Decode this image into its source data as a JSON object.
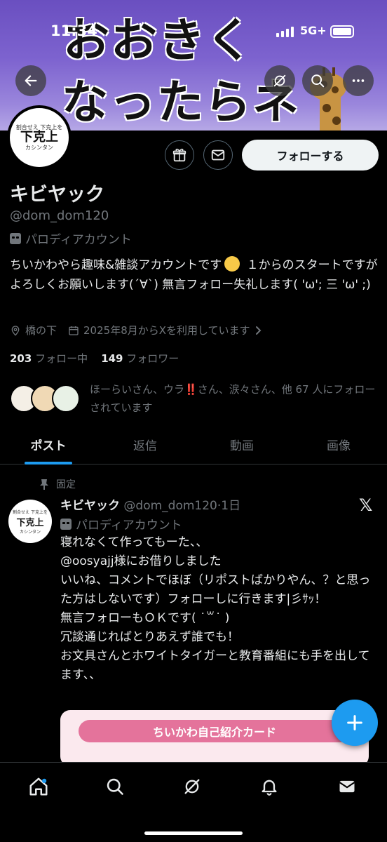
{
  "status_bar": {
    "time": "11:34",
    "network": "5G+"
  },
  "banner": {
    "line1": "おおきく",
    "line2": "なったらネ"
  },
  "avatar": {
    "small_top": "割合せえ 下克上を",
    "big": "下克上",
    "small_bottom": "カシンタン"
  },
  "profile": {
    "name": "キビヤック",
    "handle": "@dom_dom120",
    "parody_label": "パロディアカウント",
    "follow_label": "フォローする",
    "bio_part1": "ちいかわやら趣味&雑談アカウントです",
    "bio_part2": " １からのスタートですがよろしくお願いします(´∀`) 無言フォロー失礼します( 'ω'; 三 'ω' ;)",
    "location": "橋の下",
    "joined": "2025年8月からXを利用しています",
    "following_count": "203",
    "following_label": "フォロー中",
    "followers_count": "149",
    "followers_label": "フォロワー",
    "followed_by_part1": "ほーらいさん、ウラ",
    "followed_by_bang": "‼️",
    "followed_by_part2": "さん、涙々さん、他 67 人にフォローされています"
  },
  "tabs": [
    {
      "label": "ポスト",
      "active": true
    },
    {
      "label": "返信",
      "active": false
    },
    {
      "label": "動画",
      "active": false
    },
    {
      "label": "画像",
      "active": false
    }
  ],
  "post": {
    "pinned_label": "固定",
    "name": "キビヤック",
    "handle_time": "@dom_dom120·1日",
    "parody_label": "パロディアカウント",
    "lines": [
      "寝れなくて作ってもーた、、",
      "@oosyajj様にお借りしました",
      "いいね、コメントでほぼ（リポストばかりやん、？と思った方はしないです）フォローしに行きます|彡ｻｯ！",
      "無言フォローもＯＫです( ˙꒳˙ )",
      "冗談通じればとりあえず誰でも！",
      "お文具さんとホワイトタイガーと教育番組にも手を出してます、、"
    ],
    "card_title": "ちいかわ自己紹介カード"
  },
  "icons": {
    "back": "arrow-left-icon",
    "grok": "grok-icon",
    "search": "search-icon",
    "more": "more-icon",
    "gift": "gift-icon",
    "message": "envelope-icon",
    "location": "location-pin-icon",
    "calendar": "calendar-icon",
    "pin": "pin-icon",
    "x": "x-logo-icon",
    "compose": "plus-icon",
    "nav": [
      "home-icon",
      "search-icon",
      "grok-icon",
      "bell-icon",
      "envelope-icon"
    ]
  },
  "colors": {
    "accent": "#1d9bf0",
    "muted": "#71767b",
    "text": "#e7e9ea",
    "background": "#000000"
  }
}
